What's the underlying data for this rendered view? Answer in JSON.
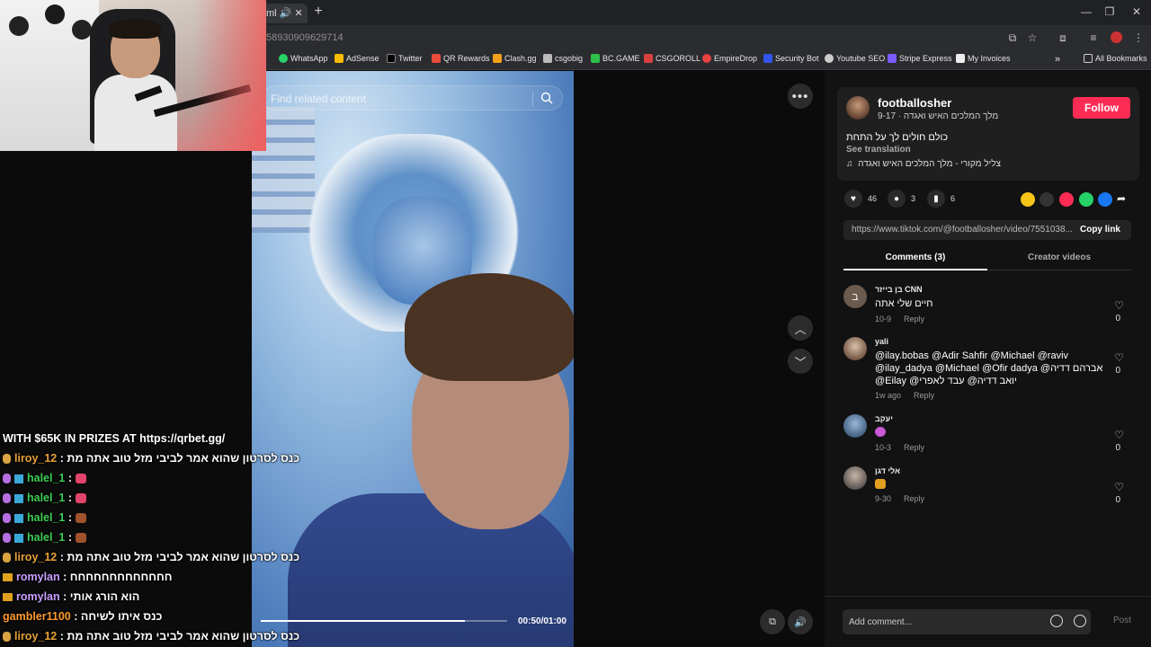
{
  "browser": {
    "tab_title": "ml",
    "url_fragment": "58930909629714",
    "bookmarks": [
      "WhatsApp",
      "AdSense",
      "Twitter",
      "QR Rewards",
      "Clash.gg",
      "csgobig",
      "BC.GAME",
      "CSGOROLL",
      "EmpireDrop",
      "Security Bot",
      "Youtube SEO",
      "Stripe Express",
      "My Invoices"
    ],
    "all_bookmarks": "All Bookmarks",
    "overflow": "»",
    "new_tab": "+"
  },
  "chat": {
    "banner": "WITH $65K IN PRIZES AT https://qrbet.gg/",
    "lines": [
      {
        "user": "liroy_12",
        "color": "#e8a23a",
        "msg": ": כנס לסרטון שהוא אמר לביבי מזל טוב אתה מת"
      },
      {
        "user": "halel_1",
        "color": "#3fce54",
        "msg": ":"
      },
      {
        "user": "halel_1",
        "color": "#3fce54",
        "msg": ":"
      },
      {
        "user": "halel_1",
        "color": "#3fce54",
        "msg": ":"
      },
      {
        "user": "halel_1",
        "color": "#3fce54",
        "msg": ":"
      },
      {
        "user": "liroy_12",
        "color": "#e8a23a",
        "msg": ": כנס לסרטון שהוא אמר לביבי מזל טוב אתה מת"
      },
      {
        "user": "romylan",
        "color": "#c9a0ff",
        "msg": ": חחחחחחחחחחחחח"
      },
      {
        "user": "romylan",
        "color": "#c9a0ff",
        "msg": ": הוא הורג אותי"
      },
      {
        "user": "gambler1100",
        "color": "#ff9a2e",
        "msg": ": כנס איתו לשיחה"
      },
      {
        "user": "liroy_12",
        "color": "#e8a23a",
        "msg": ": כנס לסרטון שהוא אמר לביבי מזל טוב אתה מת"
      }
    ]
  },
  "video": {
    "search_placeholder": "Find related content",
    "timecode": "00:50/01:00",
    "progress_fraction": 0.83
  },
  "panel": {
    "username": "footballosher",
    "subline": "מלך המלכים האיש ואגדה · 9-17",
    "follow": "Follow",
    "description": "כולם חולים לך על התחת",
    "see_translation": "See translation",
    "music": "צליל מקורי - מלך המלכים האיש ואגדה",
    "likes": "46",
    "comments_count": "3",
    "saves": "6",
    "link": "https://www.tiktok.com/@footballosher/video/7551038...",
    "copy_link": "Copy link",
    "tab_comments": "Comments (3)",
    "tab_creator": "Creator videos",
    "add_comment_placeholder": "Add comment...",
    "post": "Post"
  },
  "comments": [
    {
      "name": "בן בייזר CNN",
      "text": "חיים שלי אתה",
      "date": "10-9",
      "reply": "Reply",
      "likes": "0",
      "avatar_letter": "ב"
    },
    {
      "name": "yali",
      "text_mentions": "@ilay.bobas @Adir Sahfir @Michael @raviv @ilay_dadya @Michael @Ofir dadya @אברהם דדיה @Eilay @יואב דדיה@ עבד לאפרי",
      "date": "1w ago",
      "reply": "Reply",
      "likes": "0"
    },
    {
      "name": "יעקב",
      "date": "10-3",
      "reply": "Reply",
      "likes": "0"
    },
    {
      "name": "אלי דגן",
      "date": "9-30",
      "reply": "Reply",
      "likes": "0"
    }
  ],
  "colors": {
    "accent": "#fe2c55",
    "panel_bg": "#121212",
    "card_bg": "#1f1f1f"
  }
}
